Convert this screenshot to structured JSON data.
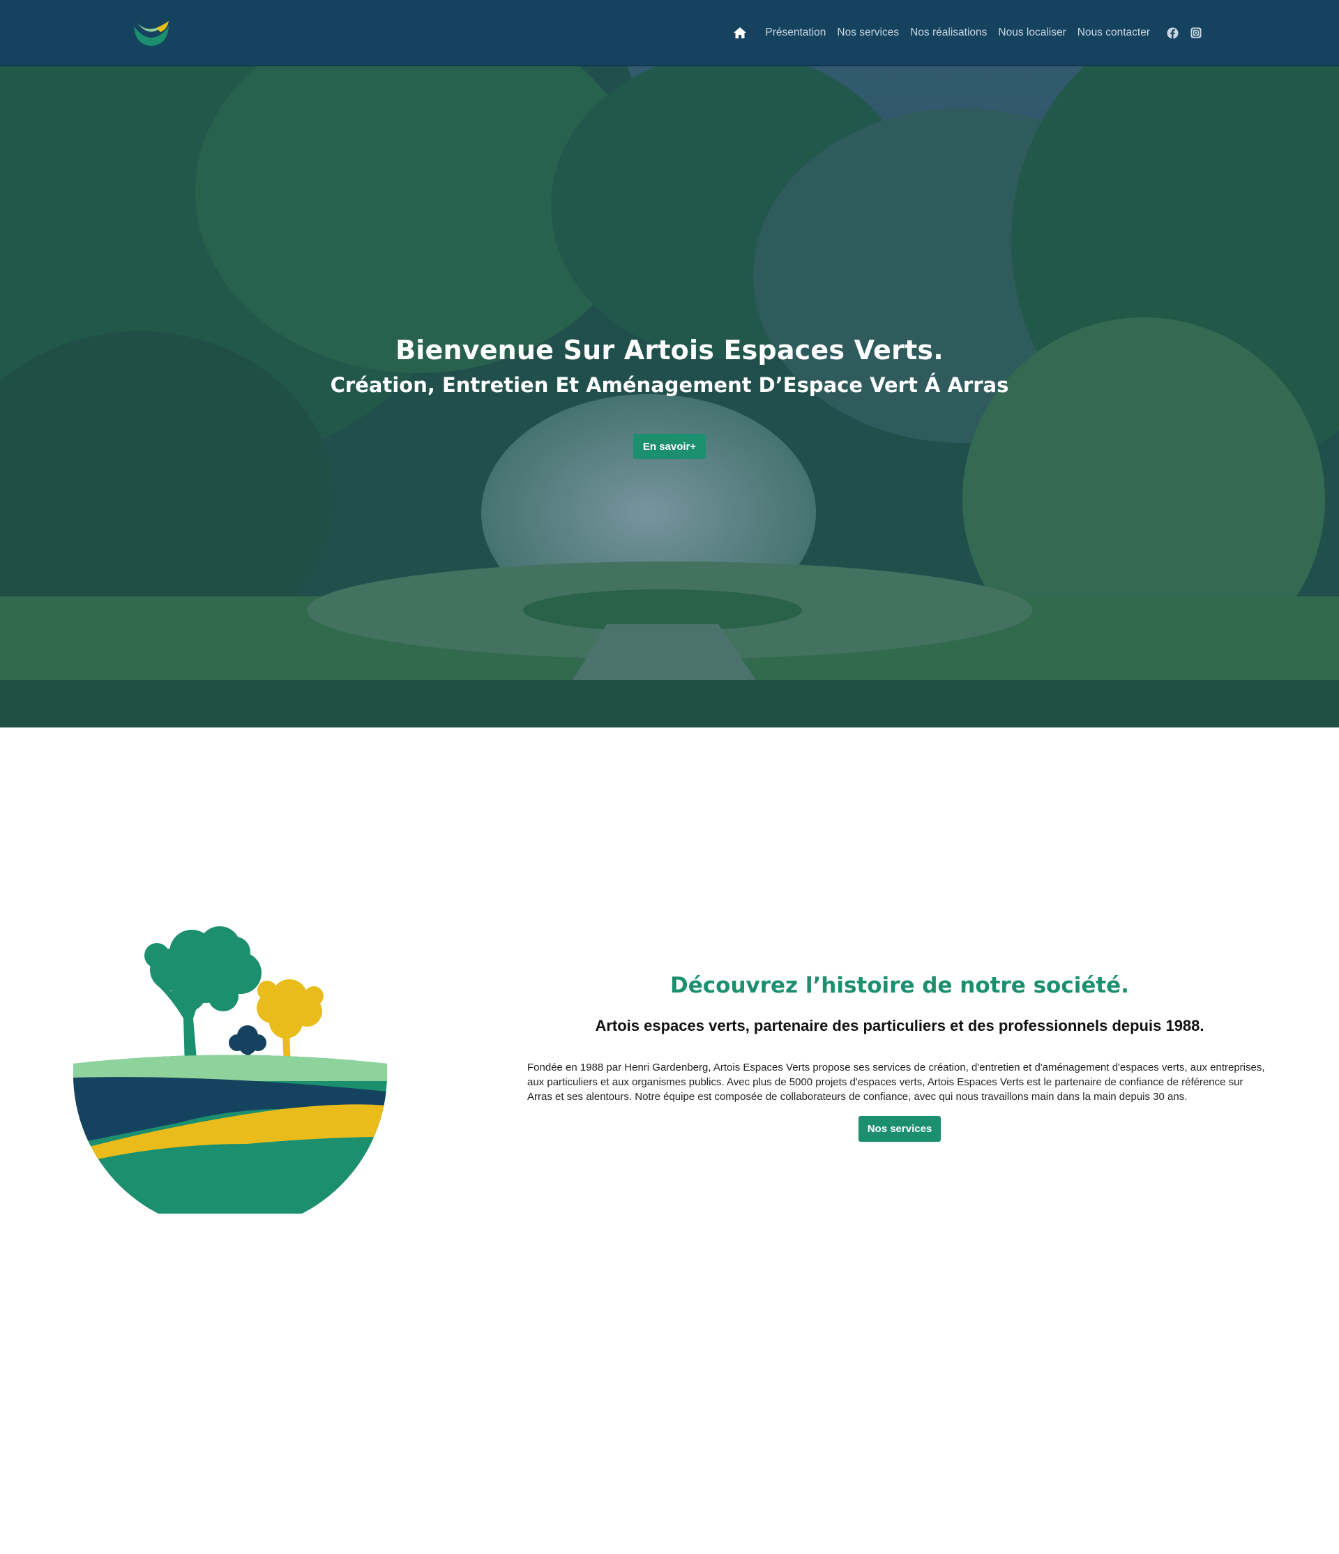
{
  "brand": {
    "primary_color": "#15425f",
    "accent_color": "#1b8f6e",
    "yellow_color": "#e9bc1b",
    "logo_icon": "leaf-smile-logo"
  },
  "nav": {
    "home_icon": "home-icon",
    "items": [
      {
        "label": "Présentation"
      },
      {
        "label": "Nos services"
      },
      {
        "label": "Nos réalisations"
      },
      {
        "label": "Nous localiser"
      },
      {
        "label": "Nous contacter"
      }
    ],
    "social": [
      {
        "icon": "facebook-icon"
      },
      {
        "icon": "instagram-icon"
      }
    ]
  },
  "hero": {
    "title": "Bienvenue Sur Artois Espaces Verts.",
    "subtitle": "Création, Entretien Et Aménagement D’Espace Vert Á Arras",
    "button_label": "En savoir+"
  },
  "about": {
    "title": "Découvrez l’histoire de notre société.",
    "subtitle": "Artois espaces verts, partenaire des particuliers et des professionnels depuis 1988.",
    "text": "Fondée en 1988 par Henri Gardenberg, Artois Espaces Verts propose ses services de création, d'entretien et d'aménagement d'espaces verts, aux entreprises, aux particuliers et aux organismes publics. Avec plus de 5000 projets d'espaces verts, Artois Espaces Verts est le partenaire de confiance de référence sur Arras et ses alentours. Notre équipe est composée de collaborateurs de confiance, avec qui nous travaillons main dans la main depuis 30 ans.",
    "button_label": "Nos services"
  }
}
